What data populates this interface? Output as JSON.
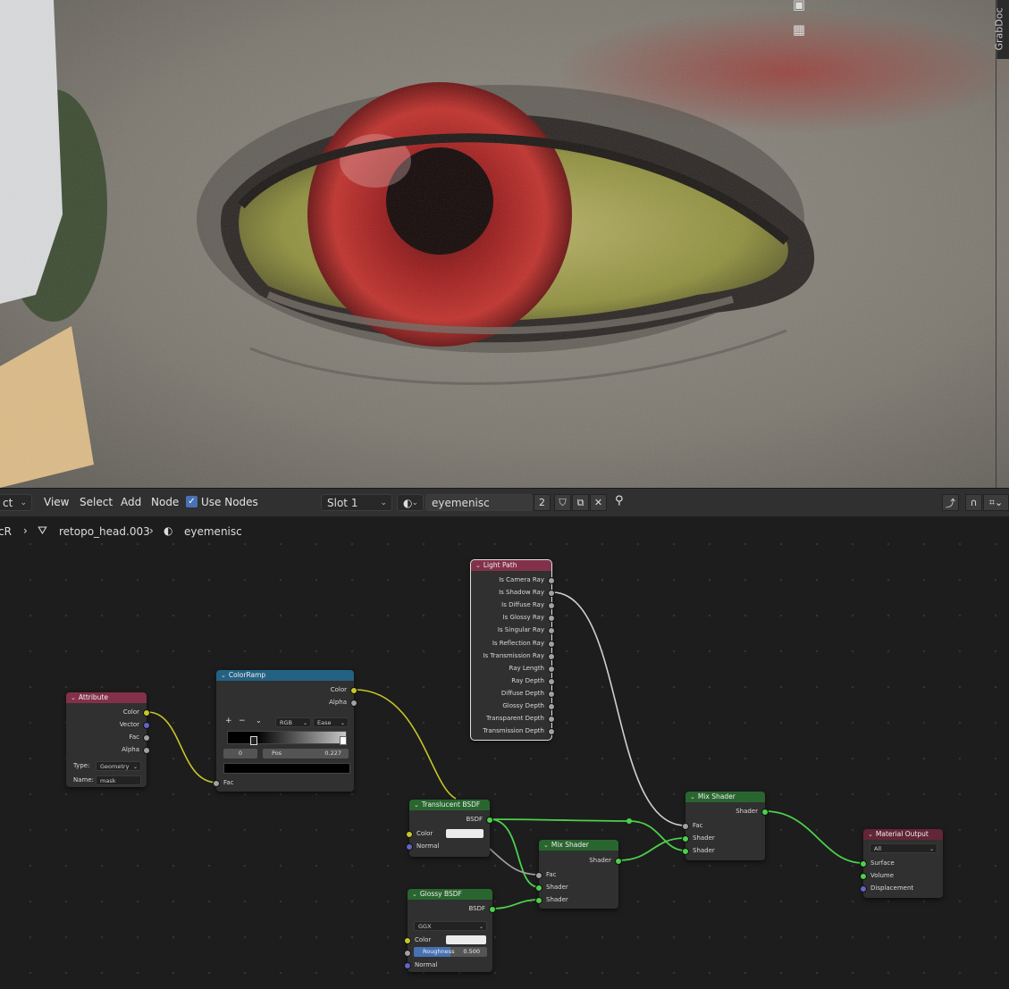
{
  "viewport": {
    "sidebar_tab": "GrabDoc",
    "gizmo_icons": [
      "camera-icon",
      "grid-icon"
    ]
  },
  "header": {
    "editor_type_label": "ct",
    "menus": [
      "View",
      "Select",
      "Add",
      "Node"
    ],
    "use_nodes_label": "Use Nodes",
    "use_nodes_checked": true,
    "slot_label": "Slot 1",
    "material_name": "eyemenisc",
    "user_count": "2"
  },
  "breadcrumb": {
    "items": [
      "cR",
      "retopo_head.003",
      "eyemenisc"
    ]
  },
  "nodes": {
    "attribute": {
      "title": "Attribute",
      "outputs": [
        "Color",
        "Vector",
        "Fac",
        "Alpha"
      ],
      "type_label": "Type:",
      "type_value": "Geometry",
      "name_label": "Name:",
      "name_value": "mask"
    },
    "colorramp": {
      "title": "ColorRamp",
      "outputs": [
        "Color",
        "Alpha"
      ],
      "add_btn": "+",
      "remove_btn": "−",
      "mode": "RGB",
      "interpolation": "Ease",
      "stop_index": "0",
      "pos_label": "Pos",
      "pos_value": "0.227",
      "input": "Fac"
    },
    "light_path": {
      "title": "Light Path",
      "outputs": [
        "Is Camera Ray",
        "Is Shadow Ray",
        "Is Diffuse Ray",
        "Is Glossy Ray",
        "Is Singular Ray",
        "Is Reflection Ray",
        "Is Transmission Ray",
        "Ray Length",
        "Ray Depth",
        "Diffuse Depth",
        "Glossy Depth",
        "Transparent Depth",
        "Transmission Depth"
      ]
    },
    "translucent": {
      "title": "Translucent BSDF",
      "output": "BSDF",
      "inputs": [
        "Color",
        "Normal"
      ],
      "color_hex": "#ececec"
    },
    "glossy": {
      "title": "Glossy BSDF",
      "output": "BSDF",
      "distribution": "GGX",
      "inputs": [
        "Color",
        "Normal"
      ],
      "roughness_label": "Roughness",
      "roughness_value": "0.500",
      "roughness_fraction": 0.5,
      "color_hex": "#ececec"
    },
    "mix1": {
      "title": "Mix Shader",
      "output": "Shader",
      "inputs": [
        "Fac",
        "Shader",
        "Shader"
      ]
    },
    "mix2": {
      "title": "Mix Shader",
      "output": "Shader",
      "inputs": [
        "Fac",
        "Shader",
        "Shader"
      ]
    },
    "output": {
      "title": "Material Output",
      "target": "All",
      "inputs": [
        "Surface",
        "Volume",
        "Displacement"
      ]
    }
  },
  "colors": {
    "input_header": "#83314a",
    "converter_header": "#246283",
    "shader_header": "#29662f",
    "output_header": "#632537",
    "socket_color": "#c7c729",
    "socket_shader": "#4cd04c",
    "socket_float": "#a1a1a1",
    "socket_vector": "#6363c7",
    "accent": "#4772b3"
  }
}
